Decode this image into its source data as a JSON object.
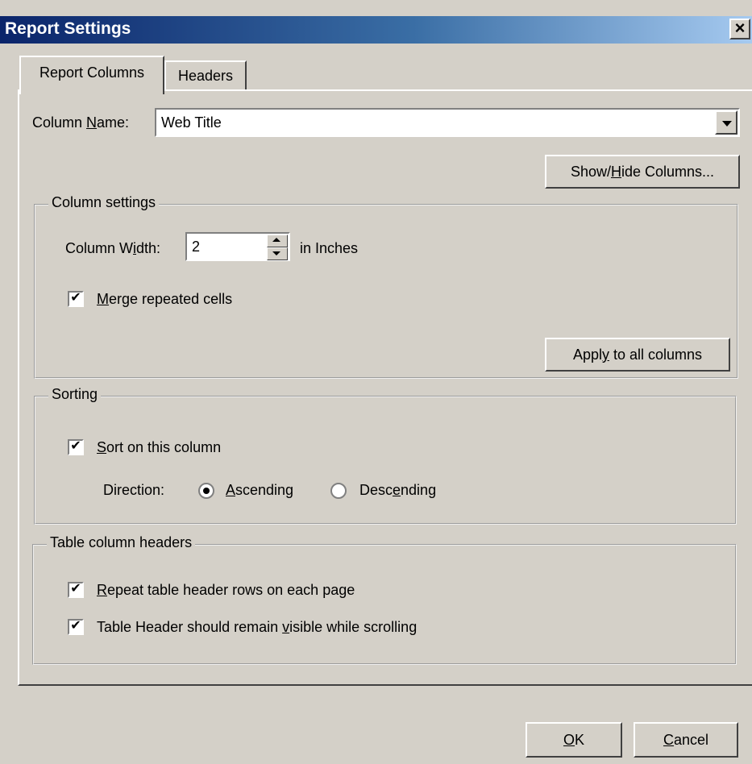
{
  "window": {
    "title": "Report Settings",
    "close_glyph": "×"
  },
  "tabs": [
    {
      "label": "Report Columns",
      "active": true
    },
    {
      "label": "Headers",
      "active": false
    }
  ],
  "column_name": {
    "label_pre": "Column ",
    "label_mnemonic": "N",
    "label_post": "ame:",
    "value": "Web Title"
  },
  "show_hide_button": {
    "pre": "Show/",
    "mnemonic": "H",
    "post": "ide Columns..."
  },
  "column_settings": {
    "legend": "Column settings",
    "width_label_pre": "Column W",
    "width_label_mnemonic": "i",
    "width_label_post": "dth:",
    "width_value": "2",
    "width_unit": "in Inches",
    "merge_checked": "✔",
    "merge_label_mnemonic": "M",
    "merge_label_rest": "erge repeated cells",
    "apply_pre": "Appl",
    "apply_mnemonic": "y",
    "apply_post": " to all columns"
  },
  "sorting": {
    "legend": "Sorting",
    "sort_checked": "✔",
    "sort_mnemonic": "S",
    "sort_rest": "ort on this column",
    "direction_label": "Direction:",
    "ascending_mnemonic": "A",
    "ascending_rest": "scending",
    "descending_pre": "Desc",
    "descending_mnemonic": "e",
    "descending_post": "nding",
    "selected": "Ascending"
  },
  "table_headers": {
    "legend": "Table column headers",
    "repeat_checked": "✔",
    "repeat_mnemonic": "R",
    "repeat_rest": "epeat table header rows on each page",
    "visible_checked": "✔",
    "visible_pre": "Table Header should remain ",
    "visible_mnemonic": "v",
    "visible_post": "isible while scrolling"
  },
  "footer": {
    "ok_mnemonic": "O",
    "ok_rest": "K",
    "cancel_mnemonic": "C",
    "cancel_rest": "ancel"
  }
}
